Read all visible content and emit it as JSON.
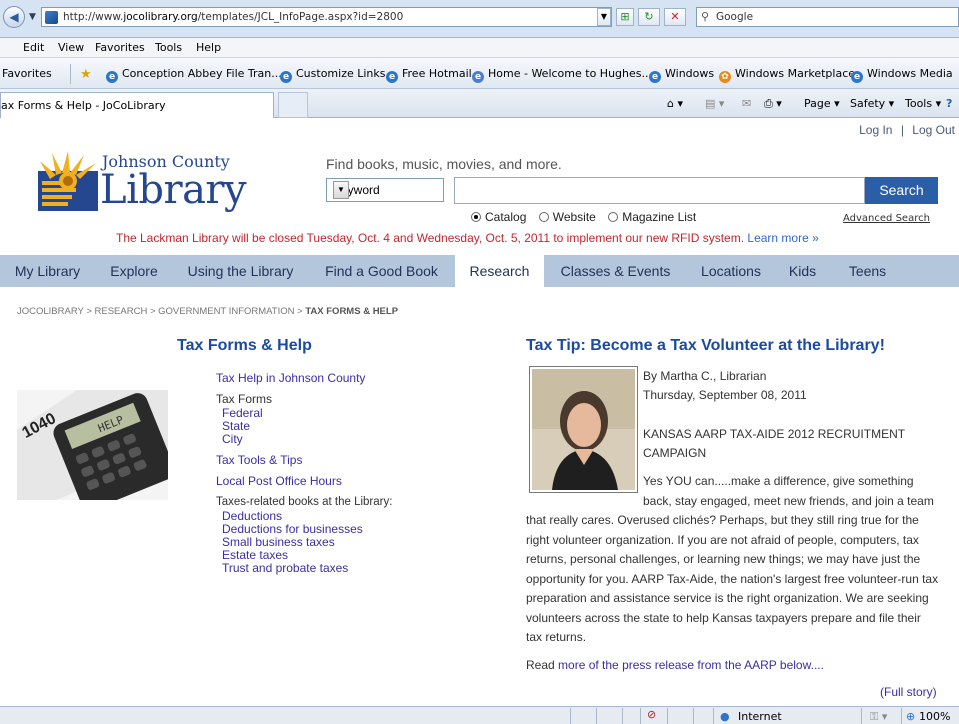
{
  "browser": {
    "url_prefix": "http://www.",
    "url_domain": "jocolibrary.org",
    "url_path": "/templates/JCL_InfoPage.aspx?id=2800",
    "search_placeholder": "Google",
    "menu": [
      "Edit",
      "View",
      "Favorites",
      "Tools",
      "Help"
    ],
    "favorites_label": "Favorites",
    "favorites": [
      "Conception Abbey File Tran...",
      "Customize Links",
      "Free Hotmail",
      "Home - Welcome to Hughes...",
      "Windows",
      "Windows Marketplace",
      "Windows Media"
    ],
    "tab_title": "ax Forms & Help - JoCoLibrary",
    "commands": [
      "Page ▾",
      "Safety ▾",
      "Tools ▾"
    ],
    "status_zone": "Internet",
    "zoom": "100%"
  },
  "header": {
    "login": "Log In",
    "sep": "|",
    "logout": "Log Out",
    "logo_line1": "Johnson County",
    "logo_line2": "Library",
    "find_label": "Find books, music, movies, and more.",
    "search_type": "Keyword",
    "search_button": "Search",
    "radio_options": [
      "Catalog",
      "Website",
      "Magazine List"
    ],
    "advanced_search": "Advanced Search",
    "alert_text": "The Lackman Library will be closed Tuesday, Oct. 4 and Wednesday, Oct. 5, 2011 to implement our new RFID system.",
    "alert_link": "Learn more »"
  },
  "nav": [
    "My Library",
    "Explore",
    "Using the Library",
    "Find a Good Book",
    "Research",
    "Classes & Events",
    "Locations",
    "Kids",
    "Teens"
  ],
  "breadcrumb": {
    "trail": "JOCOLIBRARY > RESEARCH > GOVERNMENT INFORMATION > ",
    "current": "TAX FORMS & HELP"
  },
  "left": {
    "title": "Tax Forms & Help",
    "tax_help": "Tax Help in Johnson County",
    "tax_forms_label": "Tax Forms",
    "tax_forms": [
      "Federal",
      "State",
      "City"
    ],
    "tax_tools": "Tax Tools & Tips",
    "post_office": "Local Post Office Hours",
    "books_label": "Taxes-related books at the Library:",
    "books": [
      "Deductions",
      "Deductions for businesses",
      "Small business taxes",
      "Estate taxes",
      "Trust and probate taxes"
    ]
  },
  "article": {
    "title": "Tax Tip: Become a Tax Volunteer at the Library!",
    "author": "By Martha C., Librarian",
    "date": "Thursday, September 08, 2011",
    "headline1": "KANSAS AARP TAX-AIDE 2012 RECRUITMENT",
    "headline2": "CAMPAIGN",
    "para_lines": [
      "Yes YOU can.....make a difference, give something",
      "back, stay engaged, meet new friends, and join a team",
      "that really cares. Overused clichés? Perhaps, but they still ring true for the",
      "right volunteer organization. If you are not afraid of people, computers, tax",
      "returns, personal challenges, or learning new things; we may have just the",
      "opportunity for you. AARP Tax-Aide, the nation's largest free volunteer-run tax",
      "preparation and assistance service is the right organization. We are seeking",
      "volunteers across the state to help Kansas taxpayers prepare and file their",
      "tax returns."
    ],
    "read_prefix": "Read ",
    "read_link": "more of the press release from the AARP below....",
    "full_story": "(Full story)"
  },
  "colors": {
    "link": "#3a2ea6",
    "heading": "#1c4aa2",
    "nav_bg": "#b3c6dc",
    "alert": "#c4262e",
    "button": "#2a5fa8"
  }
}
